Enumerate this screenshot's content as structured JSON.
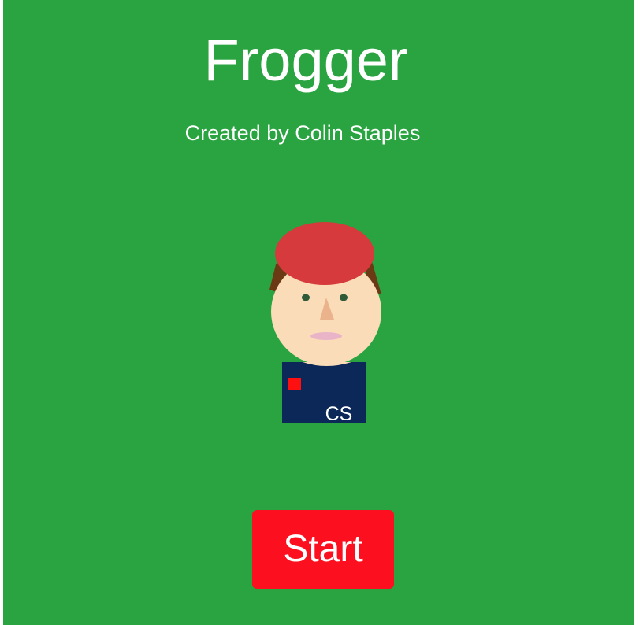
{
  "game": {
    "title": "Frogger",
    "subtitle": "Created by Colin Staples",
    "start_label": "Start"
  },
  "avatar": {
    "shirt_initials": "CS",
    "colors": {
      "hat": "#d63a3c",
      "hair": "#6b3a14",
      "skin": "#fbdcb8",
      "nose": "#eab38c",
      "mouth": "#eab4c8",
      "eyes": "#2f5a3a",
      "shirt": "#0c2858",
      "badge": "#ff1010"
    }
  },
  "colors": {
    "background": "#2aa441",
    "start_button": "#fc0f1f",
    "text": "#ffffff"
  }
}
